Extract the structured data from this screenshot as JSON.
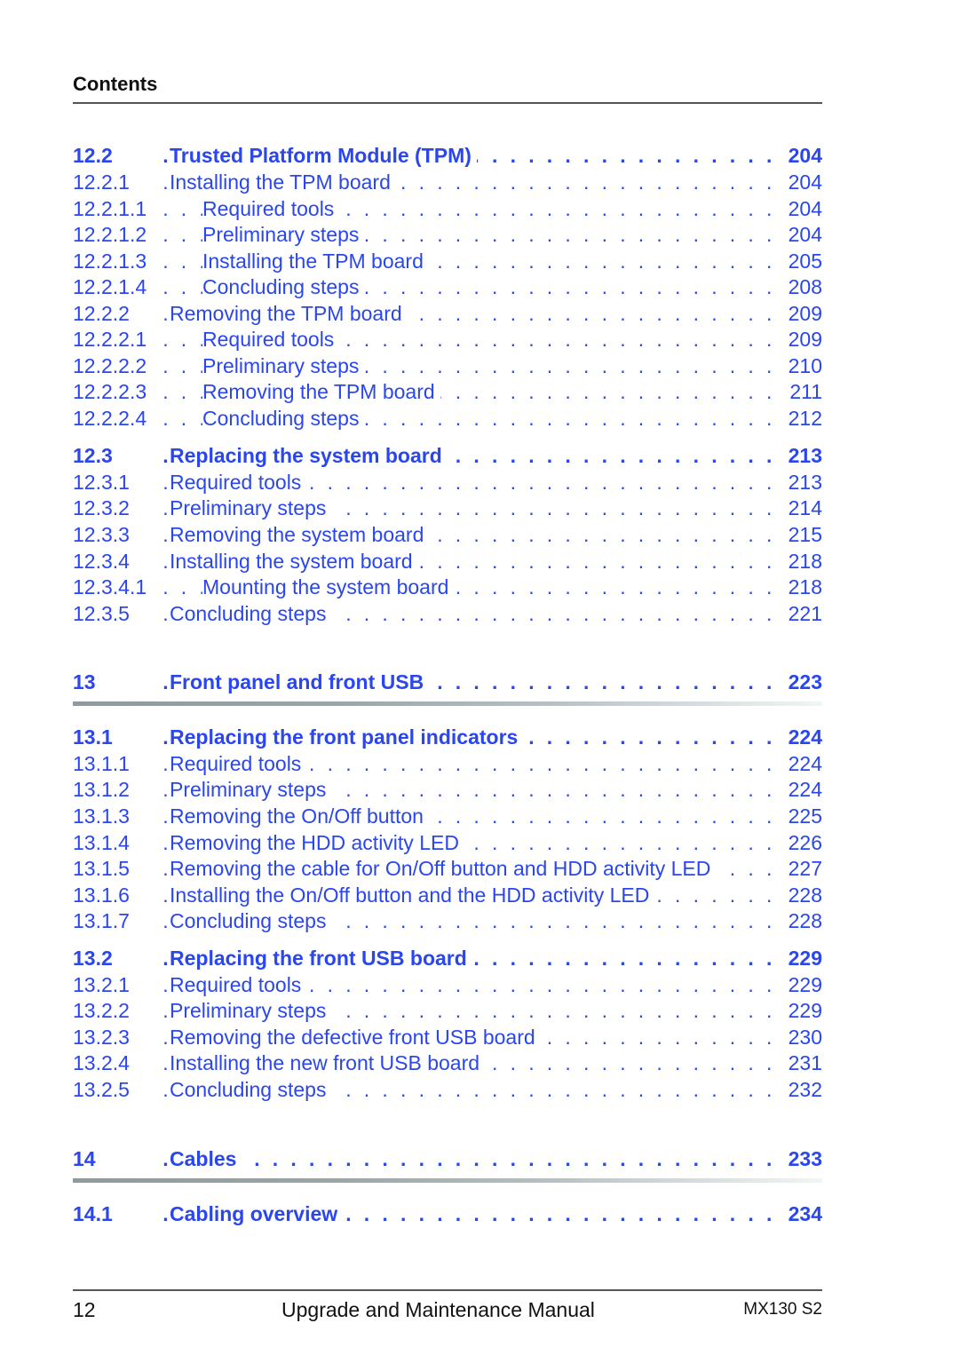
{
  "header": {
    "title": "Contents"
  },
  "colors": {
    "link": "#2a46ee",
    "text": "#111111"
  },
  "entries": [
    {
      "num": "12.2",
      "title": "Trusted Platform Module (TPM)",
      "page": "204",
      "level": 2,
      "bold": true
    },
    {
      "num": "12.2.1",
      "title": "Installing the TPM board",
      "page": "204",
      "level": 3
    },
    {
      "num": "12.2.1.1",
      "title": "Required tools",
      "page": "204",
      "level": 4
    },
    {
      "num": "12.2.1.2",
      "title": "Preliminary steps",
      "page": "204",
      "level": 4
    },
    {
      "num": "12.2.1.3",
      "title": "Installing the TPM board",
      "page": "205",
      "level": 4
    },
    {
      "num": "12.2.1.4",
      "title": "Concluding steps",
      "page": "208",
      "level": 4
    },
    {
      "num": "12.2.2",
      "title": "Removing the TPM board",
      "page": "209",
      "level": 3
    },
    {
      "num": "12.2.2.1",
      "title": "Required tools",
      "page": "209",
      "level": 4
    },
    {
      "num": "12.2.2.2",
      "title": "Preliminary steps",
      "page": "210",
      "level": 4
    },
    {
      "num": "12.2.2.3",
      "title": "Removing the TPM board",
      "page": "211",
      "level": 4
    },
    {
      "num": "12.2.2.4",
      "title": "Concluding steps",
      "page": "212",
      "level": 4
    },
    {
      "num": "12.3",
      "title": "Replacing the system board",
      "page": "213",
      "level": 2,
      "bold": true
    },
    {
      "num": "12.3.1",
      "title": "Required tools",
      "page": "213",
      "level": 3
    },
    {
      "num": "12.3.2",
      "title": "Preliminary steps",
      "page": "214",
      "level": 3
    },
    {
      "num": "12.3.3",
      "title": "Removing the system board",
      "page": "215",
      "level": 3
    },
    {
      "num": "12.3.4",
      "title": "Installing the system board",
      "page": "218",
      "level": 3
    },
    {
      "num": "12.3.4.1",
      "title": "Mounting the system board",
      "page": "218",
      "level": 4
    },
    {
      "num": "12.3.5",
      "title": "Concluding steps",
      "page": "221",
      "level": 3
    },
    {
      "num": "13",
      "title": "Front panel and front USB",
      "page": "223",
      "level": 1,
      "bold": true
    },
    {
      "num": "13.1",
      "title": "Replacing the front panel indicators",
      "page": "224",
      "level": 2,
      "bold": true
    },
    {
      "num": "13.1.1",
      "title": "Required tools",
      "page": "224",
      "level": 3
    },
    {
      "num": "13.1.2",
      "title": "Preliminary steps",
      "page": "224",
      "level": 3
    },
    {
      "num": "13.1.3",
      "title": "Removing the On/Off button",
      "page": "225",
      "level": 3
    },
    {
      "num": "13.1.4",
      "title": "Removing the HDD activity LED",
      "page": "226",
      "level": 3
    },
    {
      "num": "13.1.5",
      "title": "Removing the cable for On/Off button and HDD activity LED",
      "page": "227",
      "level": 3
    },
    {
      "num": "13.1.6",
      "title": "Installing the On/Off button and the HDD activity LED",
      "page": "228",
      "level": 3
    },
    {
      "num": "13.1.7",
      "title": "Concluding steps",
      "page": "228",
      "level": 3
    },
    {
      "num": "13.2",
      "title": "Replacing the front USB board",
      "page": "229",
      "level": 2,
      "bold": true
    },
    {
      "num": "13.2.1",
      "title": "Required tools",
      "page": "229",
      "level": 3
    },
    {
      "num": "13.2.2",
      "title": "Preliminary steps",
      "page": "229",
      "level": 3
    },
    {
      "num": "13.2.3",
      "title": "Removing the defective front USB board",
      "page": "230",
      "level": 3
    },
    {
      "num": "13.2.4",
      "title": "Installing the new front USB board",
      "page": "231",
      "level": 3
    },
    {
      "num": "13.2.5",
      "title": "Concluding steps",
      "page": "232",
      "level": 3
    },
    {
      "num": "14",
      "title": "Cables",
      "page": "233",
      "level": 1,
      "bold": true
    },
    {
      "num": "14.1",
      "title": "Cabling overview",
      "page": "234",
      "level": 2,
      "bold": true
    }
  ],
  "footer": {
    "page_number": "12",
    "manual_title": "Upgrade and Maintenance Manual",
    "model": "MX130 S2"
  }
}
